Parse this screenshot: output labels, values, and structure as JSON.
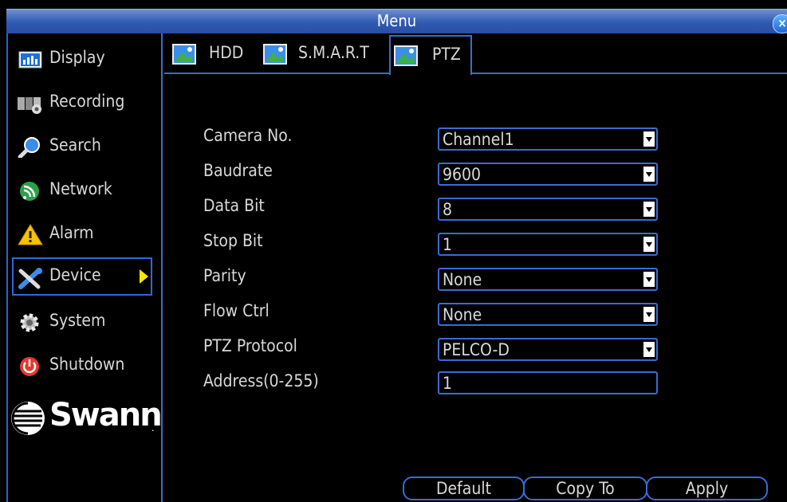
{
  "window": {
    "title": "Menu",
    "close_icon": "close-icon"
  },
  "sidebar": {
    "items": [
      {
        "label": "Display",
        "icon": "display-icon"
      },
      {
        "label": "Recording",
        "icon": "recording-icon"
      },
      {
        "label": "Search",
        "icon": "search-icon"
      },
      {
        "label": "Network",
        "icon": "network-icon"
      },
      {
        "label": "Alarm",
        "icon": "alarm-icon"
      },
      {
        "label": "Device",
        "icon": "device-icon",
        "selected": true
      },
      {
        "label": "System",
        "icon": "system-icon"
      },
      {
        "label": "Shutdown",
        "icon": "shutdown-icon"
      }
    ],
    "logo": "Swann"
  },
  "tabs": [
    {
      "label": "HDD",
      "icon": "tab-picture-icon"
    },
    {
      "label": "S.M.A.R.T",
      "icon": "tab-picture-icon"
    },
    {
      "label": "PTZ",
      "icon": "tab-picture-icon",
      "active": true
    }
  ],
  "form": {
    "camera_no": {
      "label": "Camera No.",
      "value": "Channel1"
    },
    "baudrate": {
      "label": "Baudrate",
      "value": "9600"
    },
    "data_bit": {
      "label": "Data Bit",
      "value": "8"
    },
    "stop_bit": {
      "label": "Stop Bit",
      "value": "1"
    },
    "parity": {
      "label": "Parity",
      "value": "None"
    },
    "flow_ctrl": {
      "label": "Flow Ctrl",
      "value": "None"
    },
    "ptz_protocol": {
      "label": "PTZ Protocol",
      "value": "PELCO-D"
    },
    "address": {
      "label": "Address(0-255)",
      "value": "1"
    }
  },
  "buttons": {
    "default": "Default",
    "copy_to": "Copy To",
    "apply": "Apply"
  },
  "colors": {
    "accent_border": "#3a6cd2",
    "title_bar": "#2f59b3",
    "selection_arrow": "#ffe600"
  }
}
